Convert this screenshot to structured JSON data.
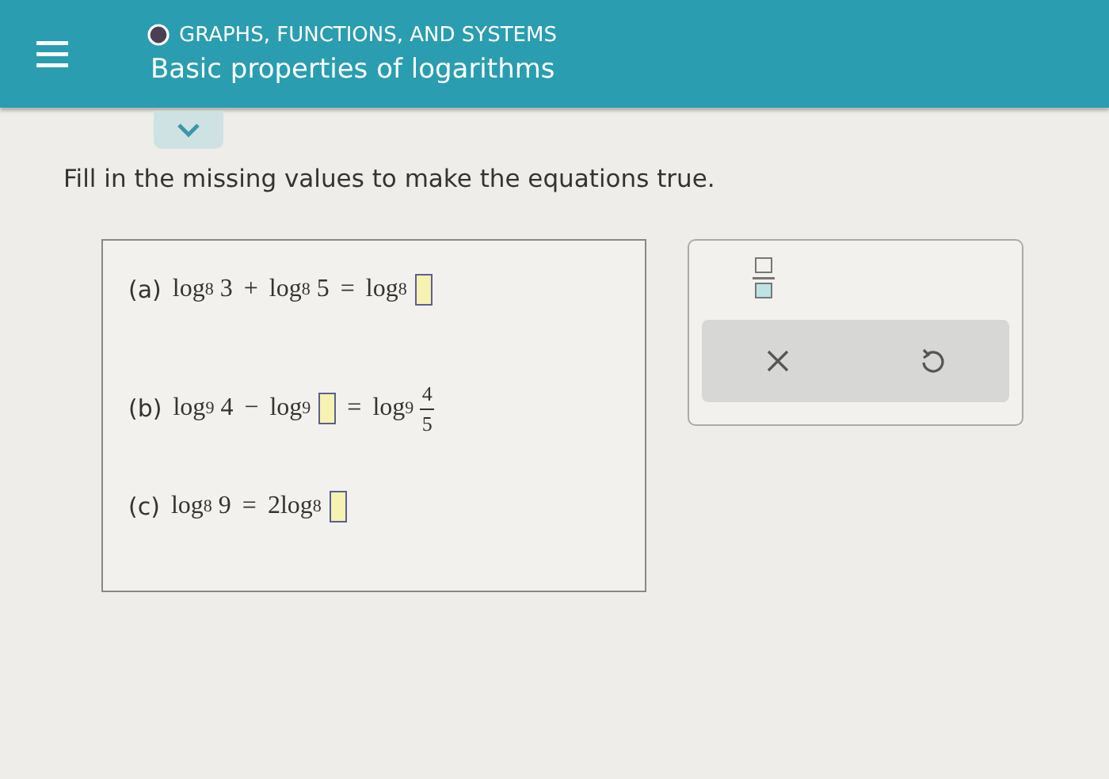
{
  "header": {
    "category": "GRAPHS, FUNCTIONS, AND SYSTEMS",
    "title": "Basic properties of logarithms"
  },
  "instruction": "Fill in the missing values to make the equations true.",
  "problems": [
    {
      "label": "(a)",
      "tokens": [
        {
          "kind": "log",
          "text": "log",
          "base": "8"
        },
        {
          "kind": "text",
          "text": "3"
        },
        {
          "kind": "op",
          "text": "+"
        },
        {
          "kind": "log",
          "text": "log",
          "base": "8"
        },
        {
          "kind": "text",
          "text": "5"
        },
        {
          "kind": "op",
          "text": "="
        },
        {
          "kind": "log",
          "text": "log",
          "base": "8"
        },
        {
          "kind": "blank"
        }
      ]
    },
    {
      "label": "(b)",
      "tokens": [
        {
          "kind": "log",
          "text": "log",
          "base": "9"
        },
        {
          "kind": "text",
          "text": "4"
        },
        {
          "kind": "op",
          "text": "−"
        },
        {
          "kind": "log",
          "text": "log",
          "base": "9"
        },
        {
          "kind": "blank"
        },
        {
          "kind": "op",
          "text": "="
        },
        {
          "kind": "log",
          "text": "log",
          "base": "9"
        },
        {
          "kind": "frac",
          "num": "4",
          "den": "5"
        }
      ]
    },
    {
      "label": "(c)",
      "tokens": [
        {
          "kind": "log",
          "text": "log",
          "base": "8"
        },
        {
          "kind": "text",
          "text": "9"
        },
        {
          "kind": "op",
          "text": "="
        },
        {
          "kind": "text",
          "text": "2"
        },
        {
          "kind": "log",
          "text": "log",
          "base": "8"
        },
        {
          "kind": "blank"
        }
      ]
    }
  ]
}
